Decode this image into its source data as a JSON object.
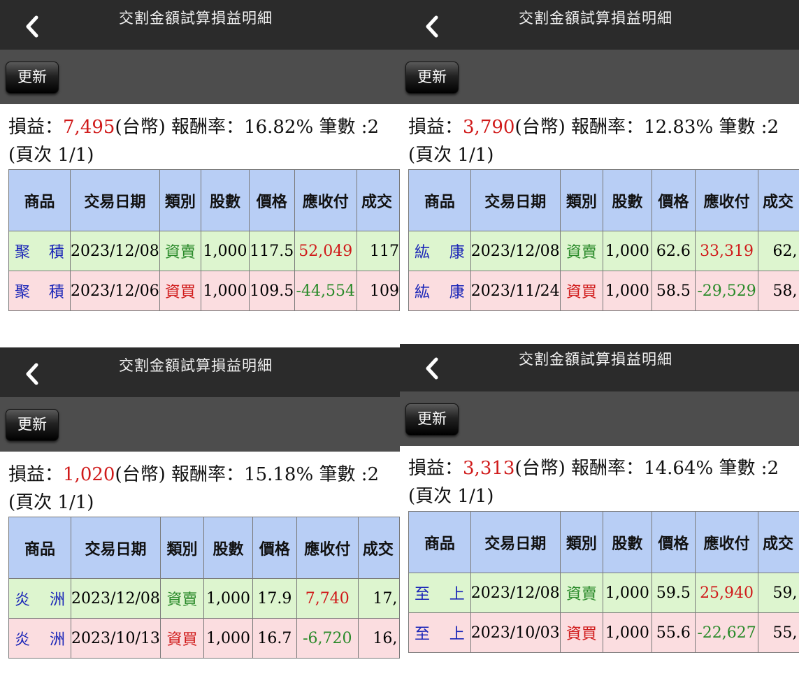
{
  "common": {
    "title": "交割金額試算損益明細",
    "refresh_label": "更新",
    "back_icon": "chevron-left-icon",
    "profit_label": "損益：",
    "currency_label": "(台幣)",
    "return_label": "報酬率：",
    "count_label": "筆數 :",
    "page_label": "(頁次 1/1)",
    "headers": [
      "商品",
      "交易日期",
      "類別",
      "股數",
      "價格",
      "應收付",
      "成交"
    ],
    "colors": {
      "header_bg": "#b8cef5",
      "sell_row": "#ddf5cf",
      "buy_row": "#fbdde0",
      "profit": "#d01a1a",
      "loss": "#2a8a2a",
      "product": "#1a25b8"
    }
  },
  "panels": [
    {
      "profit": "7,495",
      "return": "16.82%",
      "count": "2",
      "rows": [
        {
          "product": "聚　積",
          "date": "2023/12/08",
          "type": "資賣",
          "shares": "1,000",
          "price": "117.5",
          "amount": "52,049",
          "deal": "117"
        },
        {
          "product": "聚　積",
          "date": "2023/12/06",
          "type": "資買",
          "shares": "1,000",
          "price": "109.5",
          "amount": "-44,554",
          "deal": "109"
        }
      ]
    },
    {
      "profit": "3,790",
      "return": "12.83%",
      "count": "2",
      "rows": [
        {
          "product": "紘　康",
          "date": "2023/12/08",
          "type": "資賣",
          "shares": "1,000",
          "price": "62.6",
          "amount": "33,319",
          "deal": "62,"
        },
        {
          "product": "紘　康",
          "date": "2023/11/24",
          "type": "資買",
          "shares": "1,000",
          "price": "58.5",
          "amount": "-29,529",
          "deal": "58,"
        }
      ]
    },
    {
      "profit": "1,020",
      "return": "15.18%",
      "count": "2",
      "rows": [
        {
          "product": "炎　洲",
          "date": "2023/12/08",
          "type": "資賣",
          "shares": "1,000",
          "price": "17.9",
          "amount": "7,740",
          "deal": "17,"
        },
        {
          "product": "炎　洲",
          "date": "2023/10/13",
          "type": "資買",
          "shares": "1,000",
          "price": "16.7",
          "amount": "-6,720",
          "deal": "16,"
        }
      ]
    },
    {
      "profit": "3,313",
      "return": "14.64%",
      "count": "2",
      "rows": [
        {
          "product": "至　上",
          "date": "2023/12/08",
          "type": "資賣",
          "shares": "1,000",
          "price": "59.5",
          "amount": "25,940",
          "deal": "59,"
        },
        {
          "product": "至　上",
          "date": "2023/10/03",
          "type": "資買",
          "shares": "1,000",
          "price": "55.6",
          "amount": "-22,627",
          "deal": "55,"
        }
      ]
    }
  ]
}
